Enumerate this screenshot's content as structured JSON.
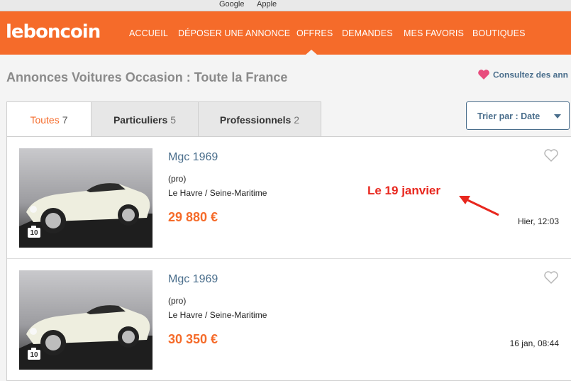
{
  "bookmarks": [
    "Google",
    "Apple"
  ],
  "brand": "leboncoin",
  "nav": [
    "ACCUEIL",
    "DÉPOSER UNE ANNONCE",
    "OFFRES",
    "DEMANDES",
    "MES FAVORIS",
    "BOUTIQUES"
  ],
  "page_title": "Annonces Voitures Occasion : Toute la France",
  "fav_promo": "Consultez des ann",
  "tabs": [
    {
      "label": "Toutes",
      "count": "7"
    },
    {
      "label": "Particuliers",
      "count": "5"
    },
    {
      "label": "Professionnels",
      "count": "2"
    }
  ],
  "sort": {
    "label": "Trier par : Date"
  },
  "listings": [
    {
      "title": "Mgc 1969",
      "category": "(pro)",
      "location": "Le Havre / Seine-Maritime",
      "price": "29 880 €",
      "date": "Hier, 12:03",
      "photos": "10"
    },
    {
      "title": "Mgc 1969",
      "category": "(pro)",
      "location": "Le Havre / Seine-Maritime",
      "price": "30 350 €",
      "date": "16 jan, 08:44",
      "photos": "10"
    }
  ],
  "annotation": "Le 19 janvier",
  "colors": {
    "brand": "#f56b2a",
    "link": "#4a6e8c",
    "annotation": "#e8271e",
    "heart": "#e84c7d"
  }
}
